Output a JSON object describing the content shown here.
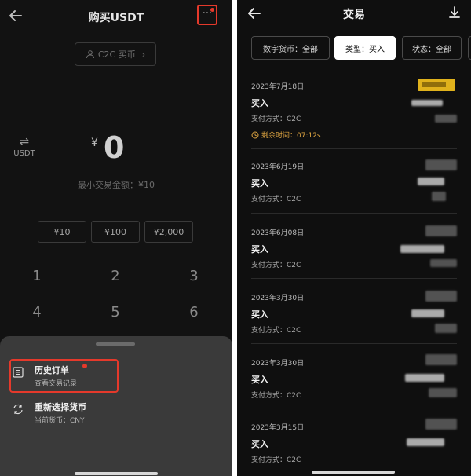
{
  "left": {
    "title": "购买USDT",
    "more_label": "···",
    "c2c_label": "C2C 买币",
    "swap_label": "USDT",
    "currency_symbol": "¥",
    "amount": "0",
    "min_amount": "最小交易金额：¥10",
    "quick_amounts": [
      "¥10",
      "¥100",
      "¥2,000"
    ],
    "keypad": [
      "1",
      "2",
      "3",
      "4",
      "5",
      "6"
    ],
    "sheet": {
      "history_title": "历史订单",
      "history_sub": "查看交易记录",
      "reselect_title": "重新选择货币",
      "reselect_sub": "当前货币：CNY"
    }
  },
  "right": {
    "title": "交易",
    "filters": [
      {
        "label": "数字货币：全部",
        "active": false
      },
      {
        "label": "类型：买入",
        "active": true
      },
      {
        "label": "状态：全部",
        "active": false
      }
    ],
    "orders": [
      {
        "date": "2023年7月18日",
        "type": "买入",
        "payment": "支付方式：C2C",
        "remaining": "剩余时间：07:12s"
      },
      {
        "date": "2023年6月19日",
        "type": "买入",
        "payment": "支付方式：C2C"
      },
      {
        "date": "2023年6月08日",
        "type": "买入",
        "payment": "支付方式：C2C"
      },
      {
        "date": "2023年3月30日",
        "type": "买入",
        "payment": "支付方式：C2C"
      },
      {
        "date": "2023年3月30日",
        "type": "买入",
        "payment": "支付方式：C2C"
      },
      {
        "date": "2023年3月15日",
        "type": "买入",
        "payment": "支付方式：C2C"
      }
    ],
    "colors": {
      "status_gold": "#e0b21c",
      "countdown": "#e3a842",
      "highlight_red": "#e5392b"
    }
  }
}
